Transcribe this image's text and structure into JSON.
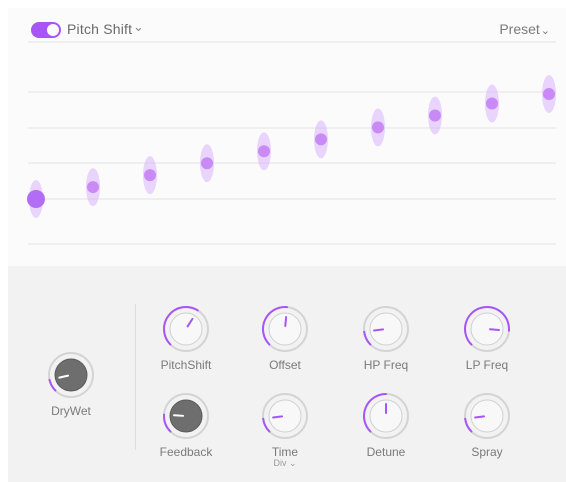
{
  "header": {
    "effect_enabled": true,
    "effect_name": "Pitch Shift",
    "effect_chevron": "⌄",
    "preset_label": "Preset",
    "preset_chevron": "⌄"
  },
  "colors": {
    "accent": "#a855f7",
    "accent_light": "#d8b4fe",
    "knob_dark": "#6b6b6b",
    "knob_light": "#f7f7f7"
  },
  "pitch_steps": [
    {
      "step": 1,
      "value": 0.0
    },
    {
      "step": 2,
      "value": 0.125
    },
    {
      "step": 3,
      "value": 0.25
    },
    {
      "step": 4,
      "value": 0.375
    },
    {
      "step": 5,
      "value": 0.5
    },
    {
      "step": 6,
      "value": 0.625
    },
    {
      "step": 7,
      "value": 0.75
    },
    {
      "step": 8,
      "value": 0.875
    },
    {
      "step": 9,
      "value": 1.0
    },
    {
      "step": 10,
      "value": 1.1
    }
  ],
  "knobs": {
    "drywet": {
      "label": "DryWet",
      "value": 0.12,
      "style": "dark"
    },
    "pitchshift": {
      "label": "PitchShift",
      "value": 0.62,
      "style": "light"
    },
    "offset": {
      "label": "Offset",
      "value": 0.52,
      "style": "light"
    },
    "hpfreq": {
      "label": "HP Freq",
      "value": 0.14,
      "style": "light"
    },
    "lpfreq": {
      "label": "LP Freq",
      "value": 0.85,
      "style": "light"
    },
    "feedback": {
      "label": "Feedback",
      "value": 0.18,
      "style": "dark"
    },
    "time": {
      "label": "Time",
      "value": 0.14,
      "style": "light",
      "sub_label": "Div ⌄"
    },
    "detune": {
      "label": "Detune",
      "value": 0.5,
      "style": "light"
    },
    "spray": {
      "label": "Spray",
      "value": 0.14,
      "style": "light"
    }
  }
}
